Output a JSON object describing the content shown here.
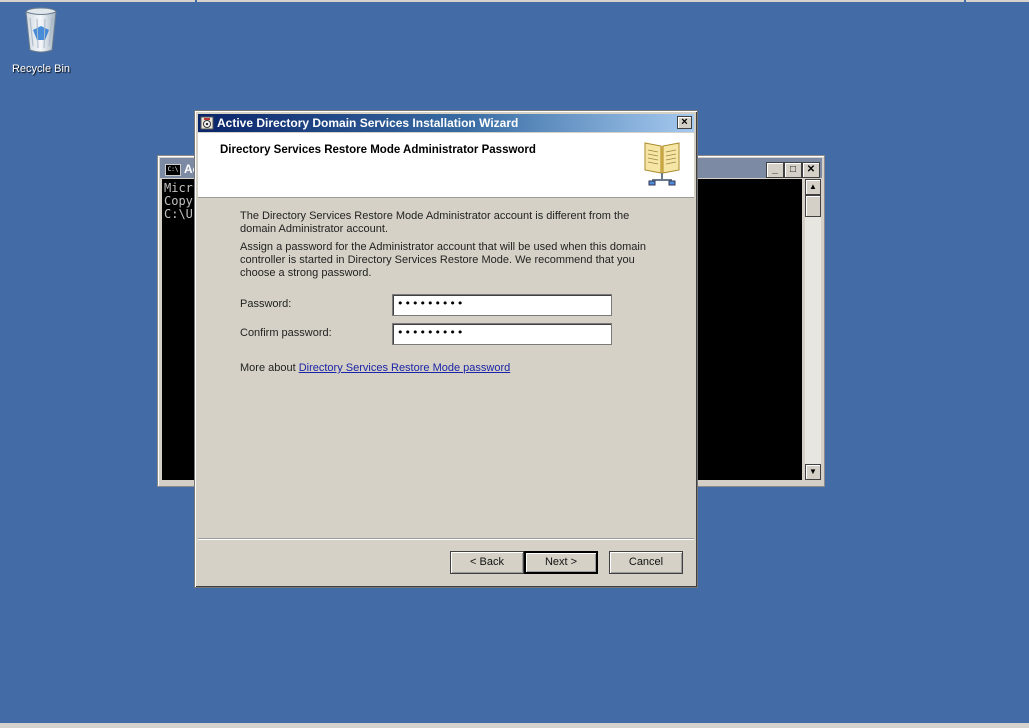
{
  "desktop": {
    "background": "#436ca7",
    "icons": [
      {
        "label": "Recycle Bin",
        "icon": "recycle-bin-icon"
      }
    ]
  },
  "cmd_window": {
    "title": "Ac",
    "icon": "command-prompt-icon",
    "console_lines": [
      "Micr",
      "Copy",
      "",
      "C:\\U"
    ]
  },
  "wizard": {
    "title": "Active Directory Domain Services Installation Wizard",
    "header_title": "Directory Services Restore Mode Administrator Password",
    "header_icon": "directory-book-icon",
    "paragraph1": "The Directory Services Restore Mode Administrator account is different from the domain Administrator account.",
    "paragraph2": "Assign a password for the Administrator account that will be used when this domain controller is started in Directory Services Restore Mode. We recommend that you choose a strong password.",
    "password_label": "Password:",
    "password_value": "•••••••••",
    "confirm_label": "Confirm password:",
    "confirm_value": "•••••••••",
    "more_prefix": "More about ",
    "more_link": "Directory Services Restore Mode password",
    "buttons": {
      "back": "< Back",
      "next": "Next >",
      "cancel": "Cancel"
    }
  }
}
